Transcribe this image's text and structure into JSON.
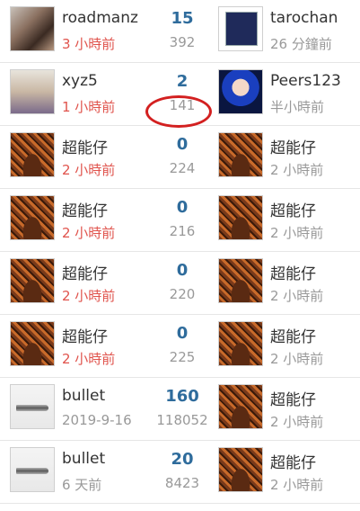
{
  "rows": [
    {
      "left": {
        "name": "roadmanz",
        "time": "3 小時前",
        "avatar": "photo-girl"
      },
      "replies": "15",
      "views": "392",
      "right": {
        "name": "tarochan",
        "time": "26 分鐘前",
        "avatar": "blue-card"
      }
    },
    {
      "left": {
        "name": "xyz5",
        "time": "1 小時前",
        "avatar": "photo-group"
      },
      "replies": "2",
      "views": "141",
      "right": {
        "name": "Peers123",
        "time": "半小時前",
        "avatar": "clown"
      }
    },
    {
      "left": {
        "name": "超能仔",
        "time": "2 小時前",
        "avatar": "beard"
      },
      "replies": "0",
      "views": "224",
      "right": {
        "name": "超能仔",
        "time": "2 小時前",
        "avatar": "beard"
      }
    },
    {
      "left": {
        "name": "超能仔",
        "time": "2 小時前",
        "avatar": "beard"
      },
      "replies": "0",
      "views": "216",
      "right": {
        "name": "超能仔",
        "time": "2 小時前",
        "avatar": "beard"
      }
    },
    {
      "left": {
        "name": "超能仔",
        "time": "2 小時前",
        "avatar": "beard"
      },
      "replies": "0",
      "views": "220",
      "right": {
        "name": "超能仔",
        "time": "2 小時前",
        "avatar": "beard"
      }
    },
    {
      "left": {
        "name": "超能仔",
        "time": "2 小時前",
        "avatar": "beard"
      },
      "replies": "0",
      "views": "225",
      "right": {
        "name": "超能仔",
        "time": "2 小時前",
        "avatar": "beard"
      }
    },
    {
      "left": {
        "name": "bullet",
        "time": "2019-9-16",
        "avatar": "bullet"
      },
      "replies": "160",
      "views": "118052",
      "right": {
        "name": "超能仔",
        "time": "2 小時前",
        "avatar": "beard"
      }
    },
    {
      "left": {
        "name": "bullet",
        "time": "6 天前",
        "avatar": "bullet"
      },
      "replies": "20",
      "views": "8423",
      "right": {
        "name": "超能仔",
        "time": "2 小時前",
        "avatar": "beard"
      }
    }
  ],
  "colors": {
    "replies": "#2f6c9c",
    "recent_time": "#e0534c",
    "muted": "#999999",
    "highlight": "#d32020"
  }
}
